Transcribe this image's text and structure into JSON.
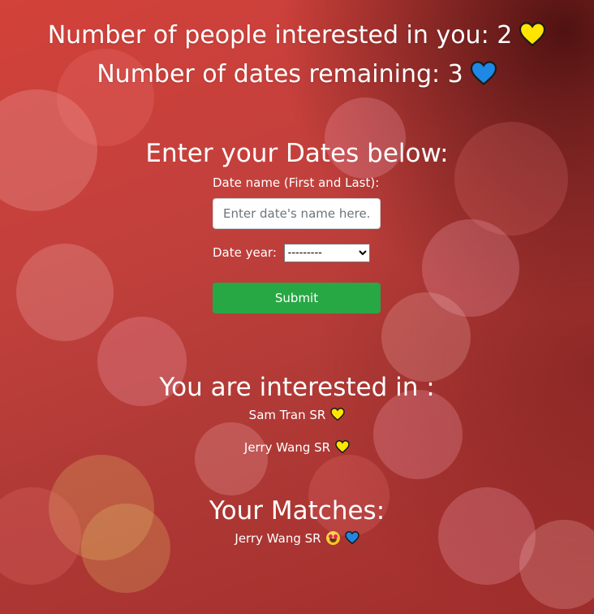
{
  "stats": {
    "interested_label": "Number of people interested in you: 2",
    "interested_icon": "yellow-heart-icon",
    "remaining_label": "Number of dates remaining: 3",
    "remaining_icon": "blue-heart-icon"
  },
  "form": {
    "title": "Enter your Dates below:",
    "name_label": "Date name (First and Last):",
    "name_placeholder": "Enter date's name here...",
    "name_value": "",
    "year_label": "Date year:",
    "year_selected": "---------",
    "submit_label": "Submit"
  },
  "interested": {
    "title": "You are interested in :",
    "items": [
      {
        "name": "Sam Tran SR",
        "icon": "yellow-heart-icon"
      },
      {
        "name": "Jerry Wang SR",
        "icon": "yellow-heart-icon"
      }
    ]
  },
  "matches": {
    "title": "Your Matches:",
    "items": [
      {
        "name": "Jerry Wang SR",
        "icons": [
          "star-struck-face-icon",
          "blue-heart-icon"
        ]
      }
    ]
  },
  "colors": {
    "submit": "#28a745",
    "yellow_heart": "#ffe500",
    "blue_heart": "#1e88e5",
    "background": "#c2403c"
  }
}
